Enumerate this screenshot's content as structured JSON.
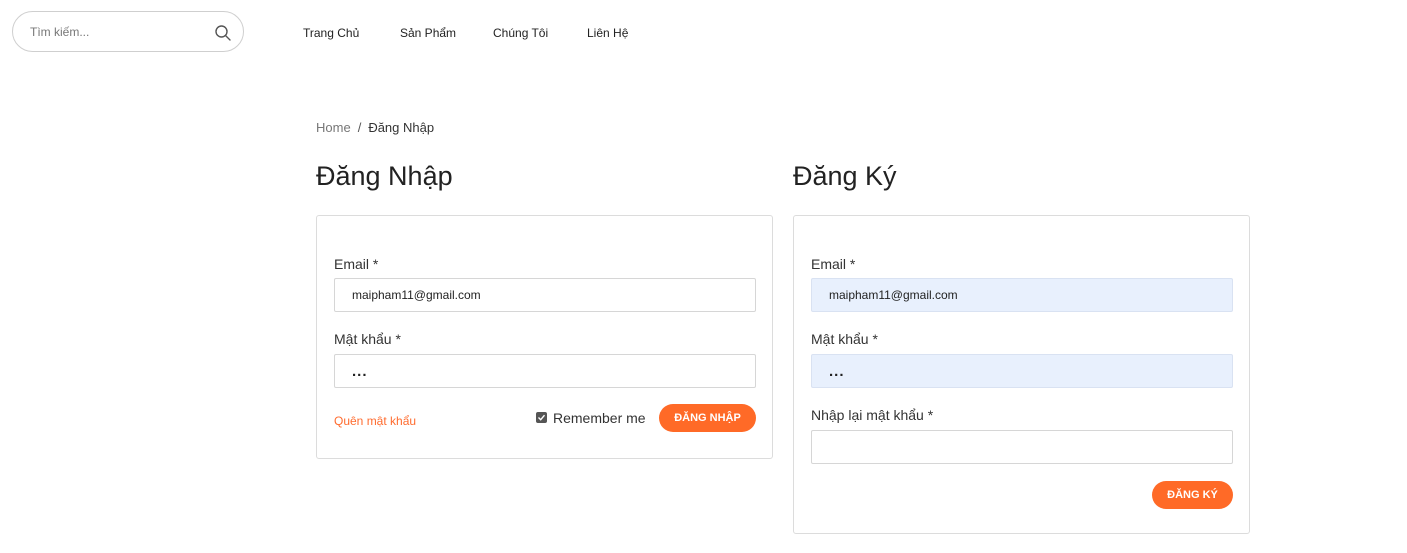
{
  "header": {
    "search": {
      "placeholder": "Tìm kiếm...",
      "icon": "search-icon"
    },
    "nav": [
      "Trang Chủ",
      "Sản Phẩm",
      "Chúng Tôi",
      "Liên Hệ"
    ]
  },
  "breadcrumb": {
    "home": "Home",
    "separator": "/",
    "current": "Đăng Nhập"
  },
  "login": {
    "title": "Đăng Nhập",
    "email_label": "Email *",
    "email_value": "maipham11@gmail.com",
    "password_label": "Mật khẩu *",
    "password_value": "...",
    "forgot_label": "Quên mật khẩu",
    "remember_label": "Remember me",
    "remember_checked": true,
    "submit_label": "ĐĂNG NHẬP"
  },
  "register": {
    "title": "Đăng Ký",
    "email_label": "Email *",
    "email_value": "maipham11@gmail.com",
    "password_label": "Mật khẩu *",
    "password_value": "...",
    "confirm_label": "Nhập lại mật khẩu *",
    "confirm_value": "",
    "submit_label": "ĐĂNG KÝ"
  },
  "colors": {
    "accent": "#ff6a27",
    "autofill": "#e8f0fd",
    "border": "#dcdcdc"
  }
}
